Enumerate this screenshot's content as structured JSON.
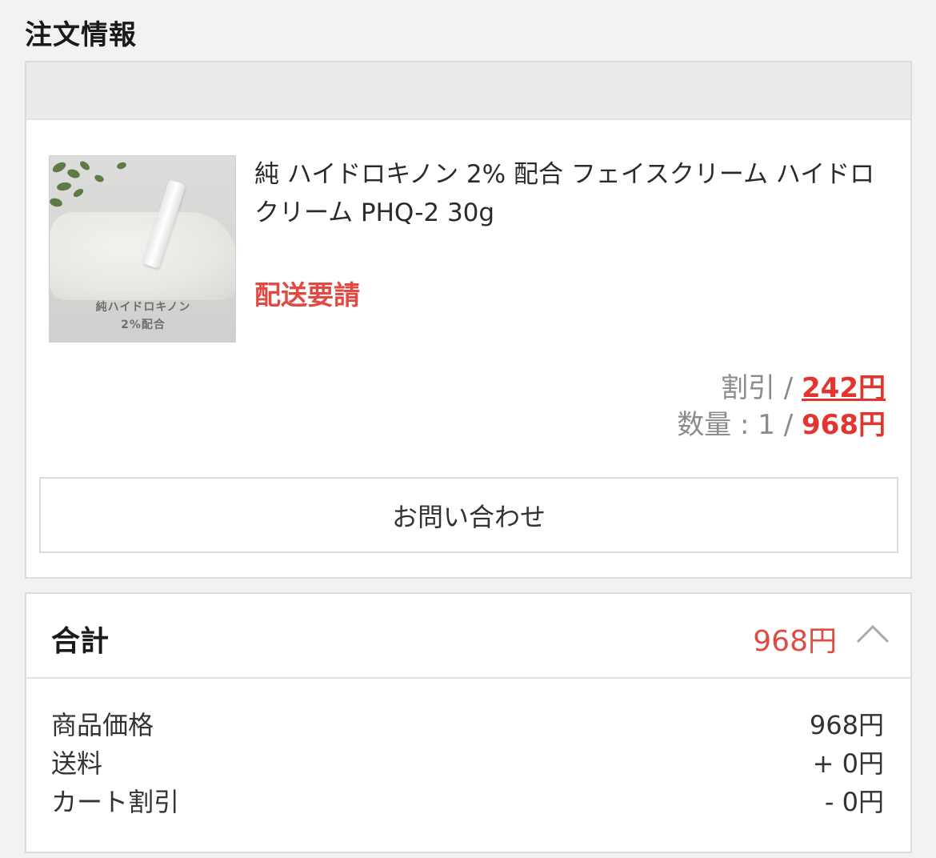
{
  "section": {
    "title": "注文情報"
  },
  "product": {
    "name": "純 ハイドロキノン 2% 配合 フェイスクリーム ハイドロクリーム PHQ-2 30g",
    "thumbnail_caption_line1": "純ハイドロキノン",
    "thumbnail_caption_line2": "2%配合",
    "status": "配送要請",
    "discount_label": "割引 / ",
    "discount_value": "242円",
    "quantity_label": "数量 : 1 / ",
    "price": "968円"
  },
  "inquiry_button": {
    "label": "お問い合わせ"
  },
  "totals": {
    "label": "合計",
    "amount": "968円",
    "breakdown": [
      {
        "label": "商品価格",
        "value": "968円"
      },
      {
        "label": "送料",
        "value": "+ 0円"
      },
      {
        "label": "カート割引",
        "value": "- 0円"
      }
    ]
  },
  "colors": {
    "accent_red": "#e3342f",
    "status_red": "#e04a43",
    "border": "#dcdcdc",
    "background": "#f2f2f2"
  },
  "icons": {
    "collapse": "chevron-up-icon"
  }
}
